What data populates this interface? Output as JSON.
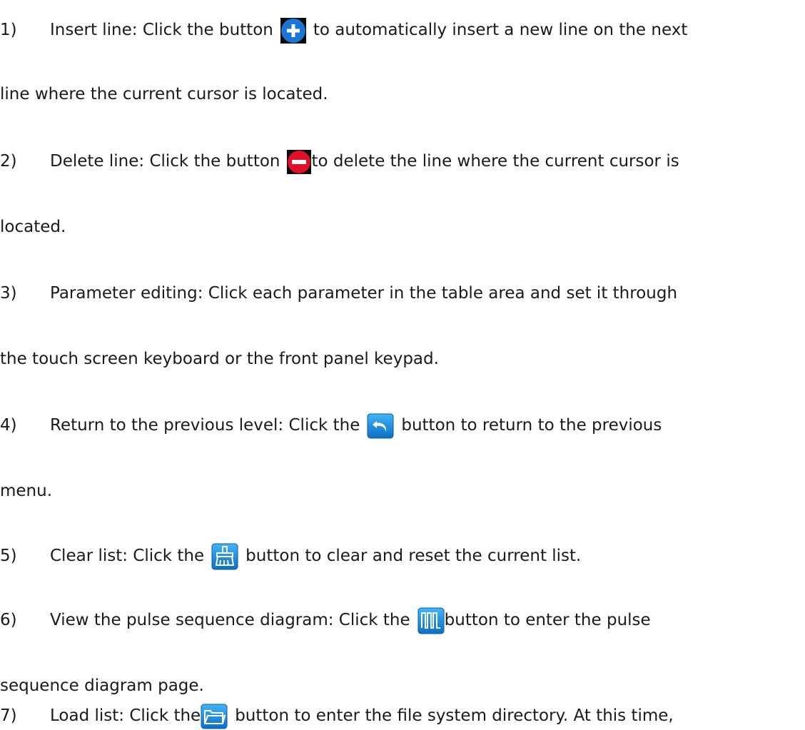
{
  "items": [
    {
      "num": "1)",
      "line1_before": "Insert line: Click the button",
      "line1_after": "to automatically insert a new line on the next",
      "line2": "line where the current cursor is located.",
      "icon": "plus-circle-icon",
      "icon_color": "#1976d2"
    },
    {
      "num": "2)",
      "line1_before": "Delete line: Click the button",
      "line1_after": "to delete the line where the current cursor is",
      "line2": "located.",
      "icon": "minus-circle-icon",
      "icon_color": "#e0102a"
    },
    {
      "num": "3)",
      "line1": "Parameter editing: Click each parameter in the table area and set it through",
      "line2": "the touch screen keyboard or the front panel keypad."
    },
    {
      "num": "4)",
      "line1_before": "Return to the previous level: Click the",
      "line1_after": "button to return to the previous",
      "line2": "menu.",
      "icon": "return-arrow-icon",
      "icon_color": "#1a8fe0"
    },
    {
      "num": "5)",
      "line1_before": "Clear list: Click the",
      "line1_after": "button to clear and reset the current list.",
      "icon": "broom-icon",
      "icon_color": "#1a8fe0"
    },
    {
      "num": "6)",
      "line1_before": "View the pulse sequence diagram: Click the",
      "line1_after": "button to enter the pulse",
      "line2": "sequence diagram page.",
      "icon": "pulse-sequence-icon",
      "icon_color": "#1a8fe0"
    },
    {
      "num": "7)",
      "line1_before": "Load list: Click the",
      "line1_after": "button to enter the file system directory. At this time,",
      "icon": "folder-icon",
      "icon_color": "#1a8fe0"
    }
  ]
}
